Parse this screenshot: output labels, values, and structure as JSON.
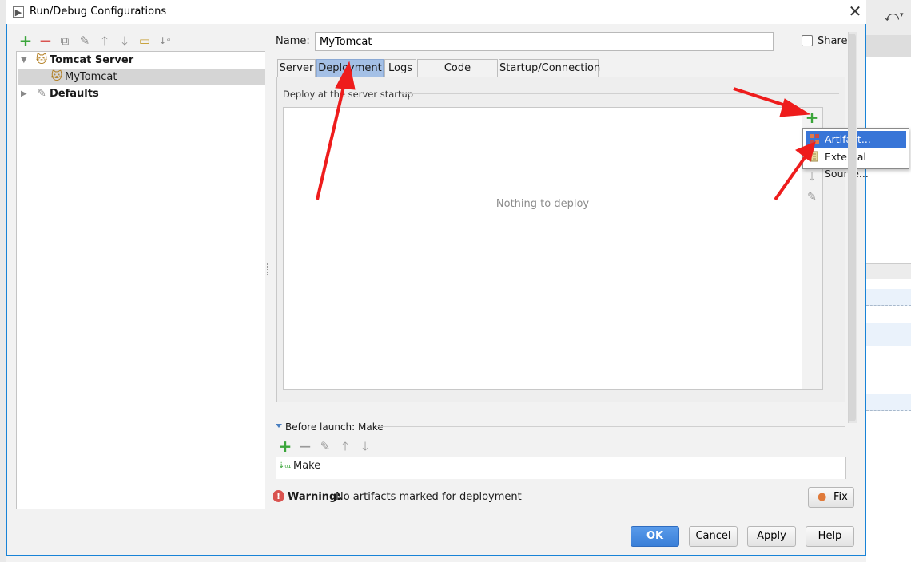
{
  "window": {
    "title": "Run/Debug Configurations",
    "close_glyph": "✕"
  },
  "tree": {
    "items": [
      {
        "label": "Tomcat Server",
        "bold": true,
        "expanded": true
      },
      {
        "label": "MyTomcat",
        "bold": false,
        "selected": true
      },
      {
        "label": "Defaults",
        "bold": true,
        "expanded": false
      }
    ]
  },
  "form": {
    "name_label": "Name:",
    "name_value": "MyTomcat",
    "share_label": "Share",
    "share_checked": false
  },
  "tabs": [
    {
      "label": "Server",
      "active": false
    },
    {
      "label": "Deployment",
      "active": true
    },
    {
      "label": "Logs",
      "active": false
    },
    {
      "label": "Code Coverage",
      "active": false
    },
    {
      "label": "Startup/Connection",
      "active": false
    }
  ],
  "deployment": {
    "group_label": "Deploy at the server startup",
    "empty_text": "Nothing to deploy",
    "add_menu": [
      {
        "label": "Artifact...",
        "selected": true,
        "icon": "artifact-icon"
      },
      {
        "label": "External Source...",
        "selected": false,
        "icon": "external-source-icon"
      }
    ]
  },
  "before_launch": {
    "title": "Before launch: Make",
    "items": [
      {
        "label": "Make",
        "icon": "make-icon"
      }
    ]
  },
  "warning": {
    "bold": "Warning:",
    "text": "No artifacts marked for deployment",
    "fix_label": "Fix"
  },
  "buttons": {
    "ok": "OK",
    "cancel": "Cancel",
    "apply": "Apply",
    "help": "Help"
  },
  "colors": {
    "accent": "#3875d7",
    "dialog_border": "#1883d7",
    "active_tab": "#a4c0e6",
    "annotation_arrow": "#ee1c1c",
    "add_green": "#3aa53a",
    "remove_red": "#d9534f"
  }
}
